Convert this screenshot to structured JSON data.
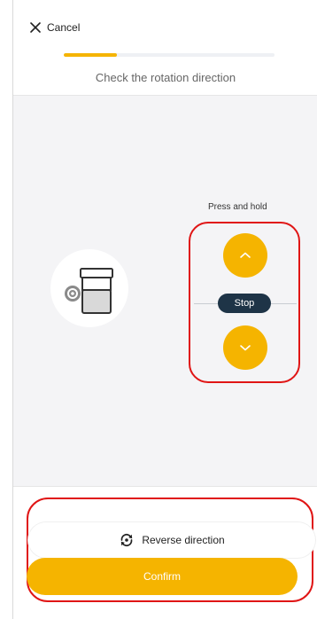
{
  "header": {
    "cancel_label": "Cancel",
    "step_title": "Check the rotation direction",
    "progress_fraction": 0.25
  },
  "controls": {
    "press_label": "Press and hold",
    "stop_label": "Stop",
    "up_icon": "chevron-up-icon",
    "down_icon": "chevron-down-icon"
  },
  "footer": {
    "reverse_label": "Reverse direction",
    "confirm_label": "Confirm"
  },
  "colors": {
    "accent": "#f5b400",
    "stop_bg": "#1e3447",
    "highlight": "#e01515"
  }
}
